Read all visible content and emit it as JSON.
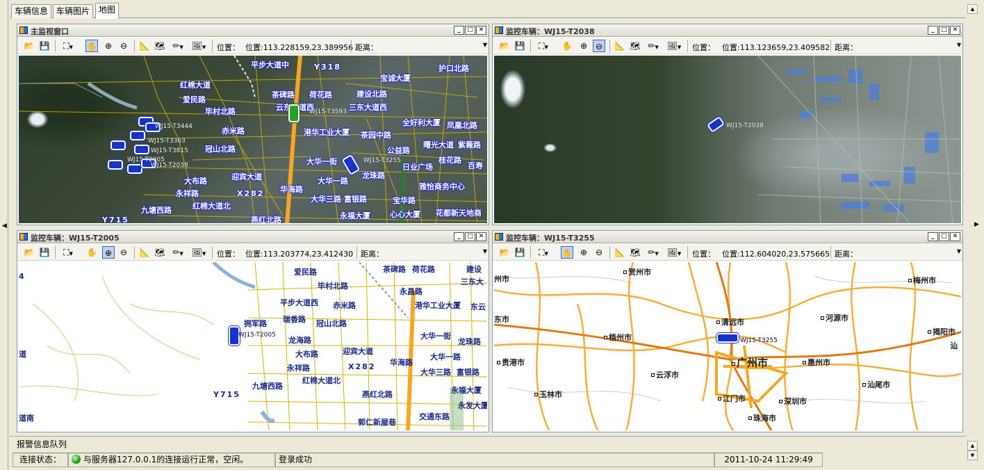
{
  "tabs": [
    "车辆信息",
    "车辆图片",
    "地图"
  ],
  "active_tab": 2,
  "toolbar": {
    "position_label": "位置：",
    "distance_label": "距离："
  },
  "panels": [
    {
      "title": "主监视窗口",
      "position": "位置:113.228159,23.389956",
      "map_labels": [
        "平步大道中",
        "Y318",
        "宝诚大厦",
        "茶碑路",
        "荷花路",
        "建设北路",
        "红棉大道",
        "云东大道西",
        "三东大道西",
        "爱民路",
        "毕村北路",
        "赤米路",
        "WJ15-T3593",
        "港华工业大厦",
        "茶园中路",
        "全好利大厦",
        "凤凰北路",
        "冠山北路",
        "公益路",
        "曙光大道",
        "紫薇路",
        "WJ15-T3444",
        "WJ15-T3363",
        "WJ15-T3815",
        "WJ15-T2005",
        "WJ15-T2038",
        "大华一街",
        "WJ15-T3255",
        "龙珠路",
        "日业广场",
        "桂花路",
        "百寿",
        "迎宾大道",
        "大华一路",
        "大布路",
        "雅怡商务中心",
        "永祥路",
        "X282",
        "华海路",
        "大华三路",
        "富银路",
        "宝华路",
        "红棉大道北",
        "九塘西路",
        "永福大厦",
        "心心大厦",
        "花都新天地商",
        "Y715",
        "燕红北路",
        "护口北路"
      ]
    },
    {
      "title": "监控车辆：WJ15-T2038",
      "position": "位置:113.123659,23.409582",
      "map_labels": [
        "WJ15-T2038"
      ]
    },
    {
      "title": "监控车辆：WJ15-T2005",
      "position": "位置:113.203774,23.412430",
      "map_labels": [
        "爱民路",
        "茶碑路",
        "荷花路",
        "建设",
        "毕村北路",
        "三东大",
        "永昌路",
        "平步大道西",
        "赤米路",
        "港华工业大厦",
        "东云",
        "拥军路",
        "瑞香路",
        "冠山北路",
        "WJ15-T2005",
        "龙海路",
        "大华一街",
        "龙珠路",
        "迎宾大道",
        "大布路",
        "大华一路",
        "永祥路",
        "X282",
        "华海路",
        "红棉大道北",
        "大华三路",
        "富银路",
        "九塘西路",
        "永福大厦",
        "Y715",
        "燕红北路",
        "永发大厦",
        "交通东路",
        "郭仁新屋巷",
        "道南",
        "4",
        "道"
      ]
    },
    {
      "title": "监控车辆：WJ15-T3255",
      "position": "位置:112.604020,23.575665",
      "map_labels": [
        "贺州市",
        "梅州市",
        "清远市",
        "河源市",
        "揭阳市",
        "梧州市",
        "WJ15-T3255",
        "广州市",
        "惠州市",
        "云浮市",
        "贵港市",
        "汕尾市",
        "玉林市",
        "江门市",
        "深圳市",
        "珠海市",
        "汕",
        "东市",
        "州市"
      ]
    }
  ],
  "alarm_queue_label": "报警信息队列",
  "status_bar": {
    "connection_label": "连接状态：",
    "connection_text": "与服务器127.0.0.1的连接运行正常，空闲。",
    "login_text": "登录成功",
    "datetime": "2011-10-24  11:29:49"
  },
  "colors": {
    "road_yellow": "#f5a623",
    "road_orange": "#e07a10",
    "vehicle_blue": "#1834c8",
    "label_blue": "#1a2a8a"
  }
}
